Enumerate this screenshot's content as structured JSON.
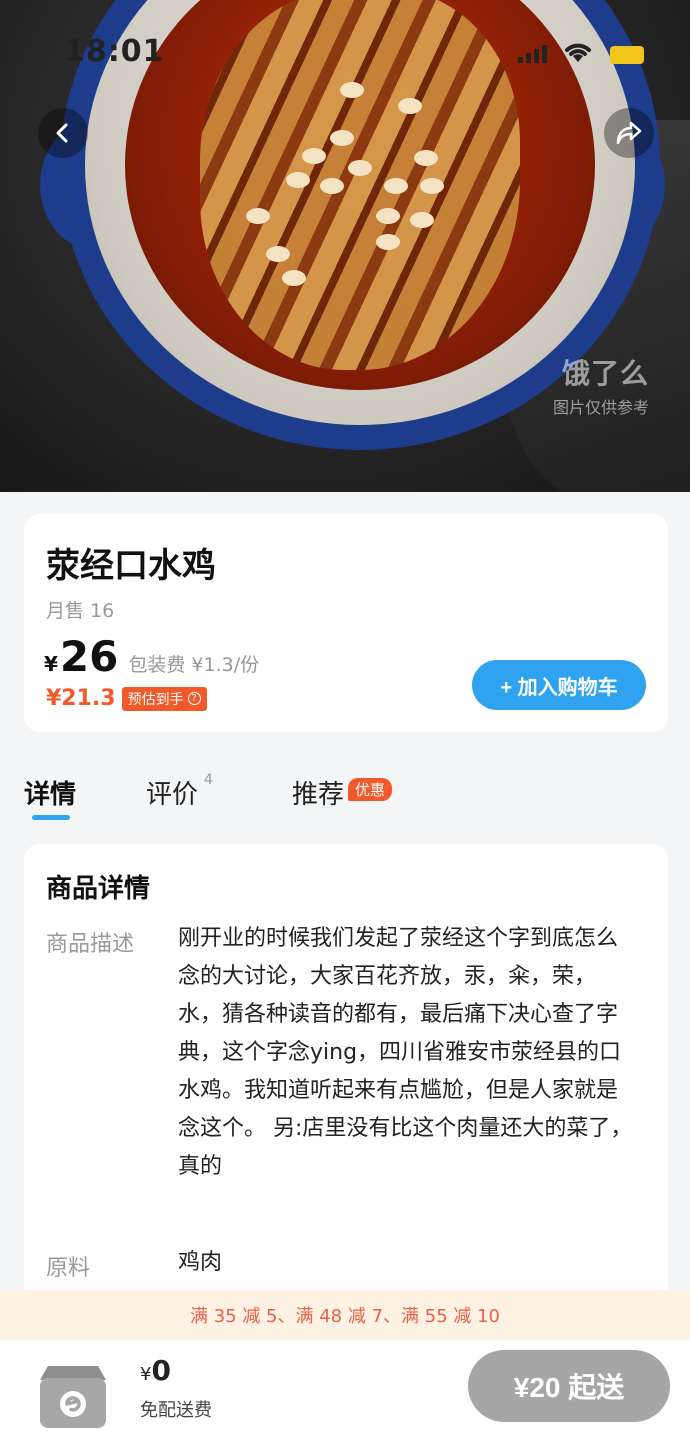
{
  "status_bar": {
    "time": "18:01"
  },
  "hero": {
    "watermark_brand": "饿了么",
    "watermark_note": "图片仅供参考"
  },
  "product": {
    "name": "荥经口水鸡",
    "monthly_sales": "月售 16",
    "currency": "¥",
    "price": "26",
    "packing_fee": "包装费 ¥1.3/份",
    "estimated_price": "¥21.3",
    "estimated_label": "预估到手",
    "add_to_cart": "+ 加入购物车"
  },
  "tabs": [
    {
      "label": "详情",
      "active": true
    },
    {
      "label": "评价",
      "count": "4"
    },
    {
      "label": "推荐",
      "badge": "优惠"
    }
  ],
  "details": {
    "title": "商品详情",
    "description_label": "商品描述",
    "description": "刚开业的时候我们发起了荥经这个字到底怎么念的大讨论，大家百花齐放，汞，籴，荣，水，猜各种读音的都有，最后痛下决心查了字典，这个字念ying，四川省雅安市荥经县的口水鸡。我知道听起来有点尴尬，但是人家就是念这个。 另:店里没有比这个肉量还大的菜了，真的",
    "ingredients_label": "原料",
    "ingredients": "鸡肉"
  },
  "promotions": "满 35 减 5、满 48 减 7、满 55 减 10",
  "cart": {
    "currency": "¥",
    "amount": "0",
    "delivery": "免配送费",
    "min_order": "¥20 起送"
  },
  "colors": {
    "accent": "#2fa3f0",
    "promo": "#f05a2b",
    "disabled": "#a6a6a6"
  }
}
